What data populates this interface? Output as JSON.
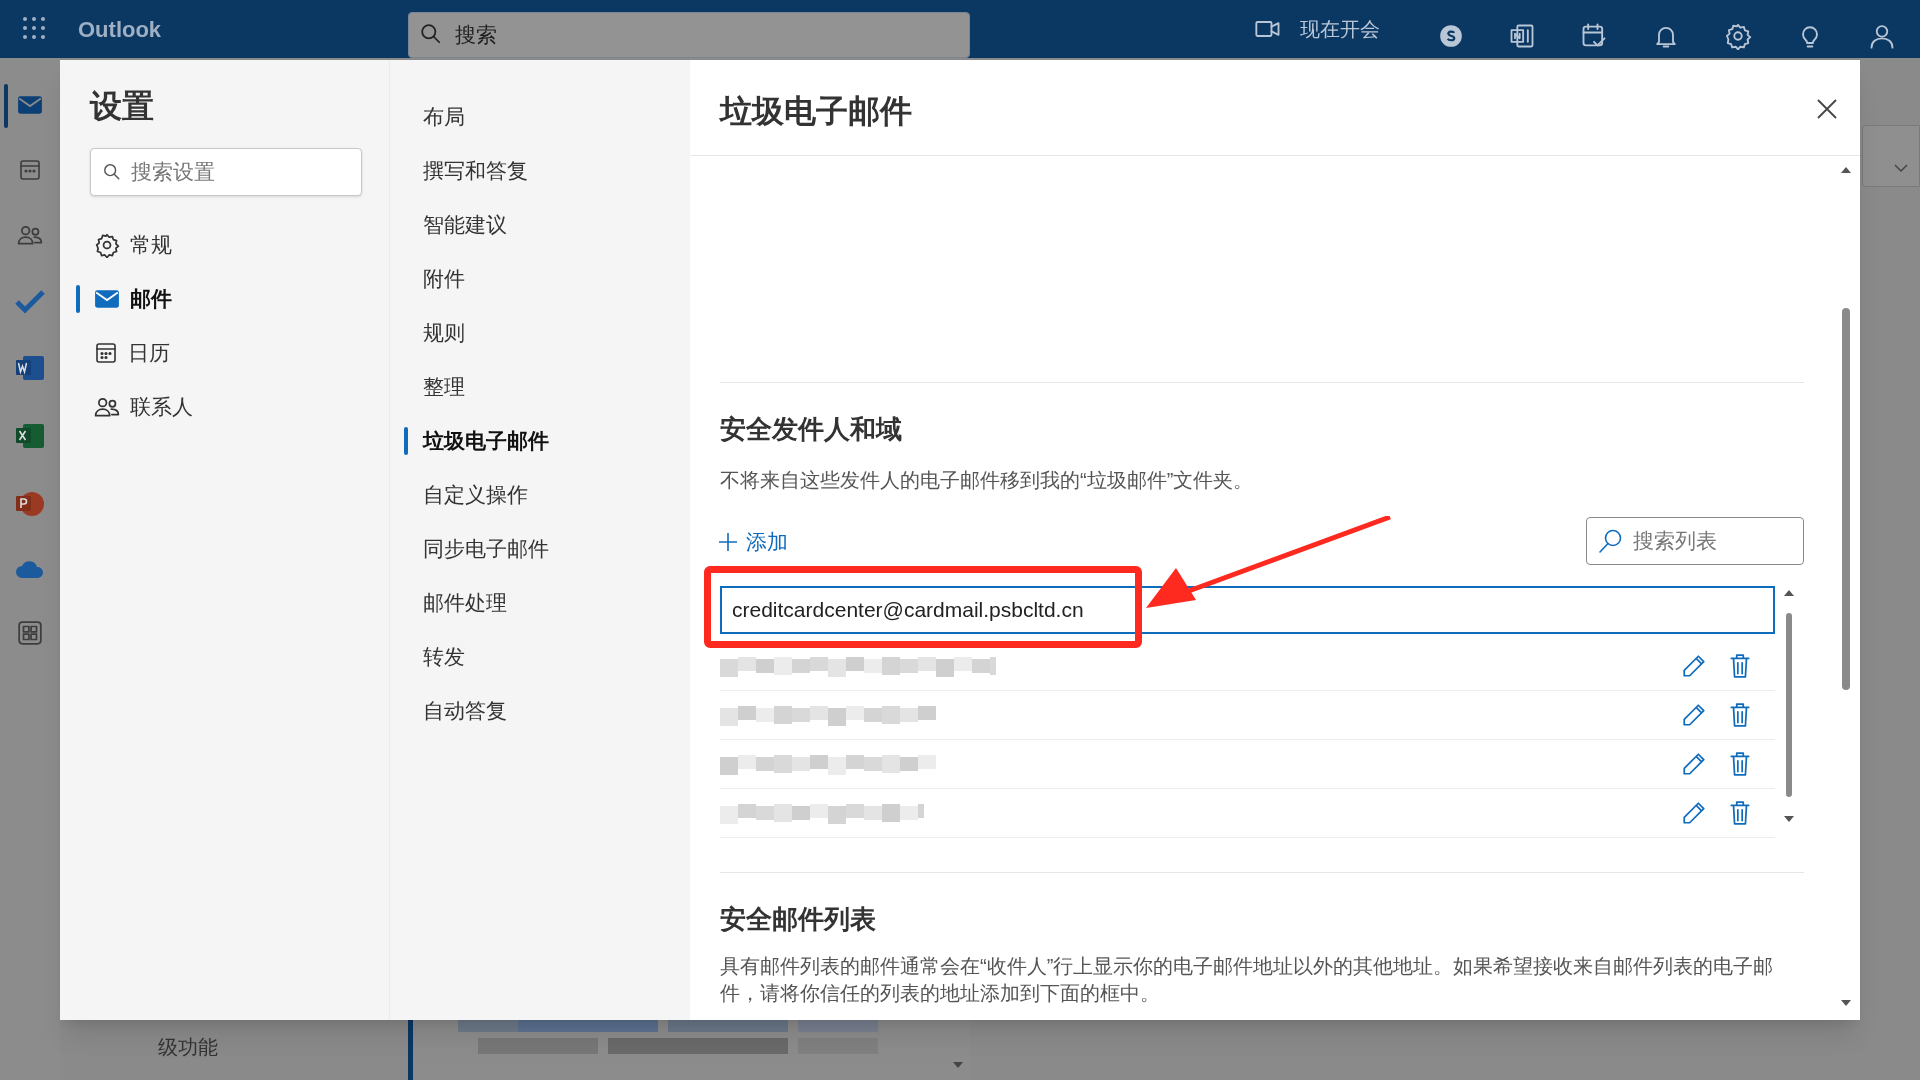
{
  "app_bar": {
    "title": "Outlook",
    "search": {
      "placeholder": "搜索"
    },
    "meet_now": "现在开会"
  },
  "background": {
    "promo_lines": [
      "级功能"
    ]
  },
  "settings": {
    "title": "设置",
    "search": {
      "placeholder": "搜索设置"
    },
    "categories": [
      {
        "label": "常规",
        "selected": false
      },
      {
        "label": "邮件",
        "selected": true
      },
      {
        "label": "日历",
        "selected": false
      },
      {
        "label": "联系人",
        "selected": false
      }
    ],
    "subsections": [
      {
        "label": "布局",
        "selected": false
      },
      {
        "label": "撰写和答复",
        "selected": false
      },
      {
        "label": "智能建议",
        "selected": false
      },
      {
        "label": "附件",
        "selected": false
      },
      {
        "label": "规则",
        "selected": false
      },
      {
        "label": "整理",
        "selected": false
      },
      {
        "label": "垃圾电子邮件",
        "selected": true
      },
      {
        "label": "自定义操作",
        "selected": false
      },
      {
        "label": "同步电子邮件",
        "selected": false
      },
      {
        "label": "邮件处理",
        "selected": false
      },
      {
        "label": "转发",
        "selected": false
      },
      {
        "label": "自动答复",
        "selected": false
      }
    ]
  },
  "panel": {
    "title": "垃圾电子邮件",
    "safe_senders": {
      "heading": "安全发件人和域",
      "description": "不将来自这些发件人的电子邮件移到我的“垃圾邮件”文件夹。",
      "add": "添加",
      "search": {
        "placeholder": "搜索列表"
      },
      "new_entry": "creditcardcenter@cardmail.psbcltd.cn",
      "entries": [
        {
          "kind": "redacted"
        },
        {
          "kind": "redacted"
        },
        {
          "kind": "redacted"
        },
        {
          "kind": "redacted"
        }
      ]
    },
    "safe_lists": {
      "heading": "安全邮件列表",
      "description": "具有邮件列表的邮件通常会在“收件人”行上显示你的电子邮件地址以外的其他地址。如果希望接收来自邮件列表的电子邮件，请将你信任的列表的地址添加到下面的框中。"
    }
  },
  "annotations": {
    "highlight_box": true,
    "arrow": true
  }
}
